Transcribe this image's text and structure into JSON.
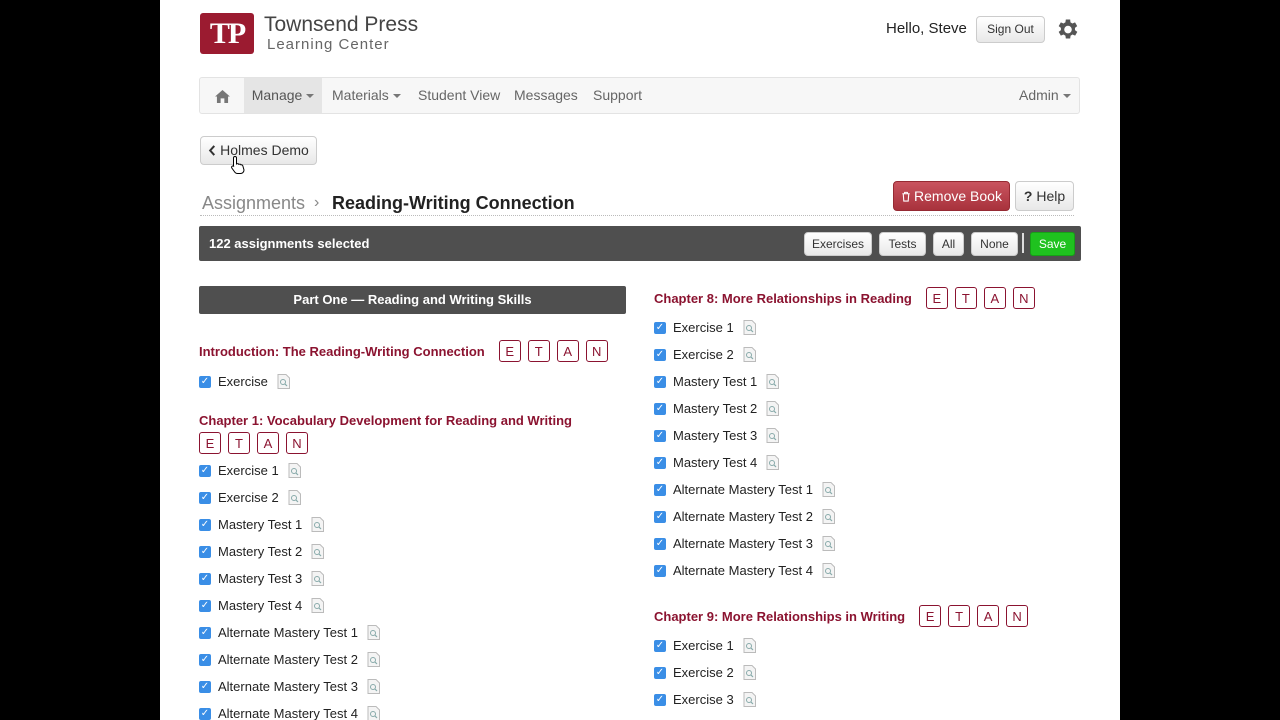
{
  "brand": {
    "logo": "TP",
    "title": "Townsend Press",
    "subtitle": "Learning Center"
  },
  "header": {
    "greeting": "Hello, Steve",
    "sign_out": "Sign Out",
    "settings_icon": "gear-icon"
  },
  "nav": {
    "home_icon": "home-icon",
    "items": [
      "Manage",
      "Materials",
      "Student View",
      "Messages",
      "Support"
    ],
    "right": "Admin"
  },
  "back_label": "Holmes Demo",
  "breadcrumb": {
    "parent": "Assignments",
    "current": "Reading-Writing Connection"
  },
  "actions": {
    "remove_book": "Remove Book",
    "help": "Help"
  },
  "selection": {
    "count_text": "122 assignments selected",
    "buttons": [
      "Exercises",
      "Tests",
      "All",
      "None"
    ],
    "save": "Save"
  },
  "letters": [
    "E",
    "T",
    "A",
    "N"
  ],
  "part_title": "Part One — Reading and Writing Skills",
  "left_sections": [
    {
      "title": "Introduction: The Reading-Writing Connection",
      "items": [
        "Exercise"
      ]
    },
    {
      "title": "Chapter 1: Vocabulary Development for Reading and Writing",
      "items": [
        "Exercise 1",
        "Exercise 2",
        "Mastery Test 1",
        "Mastery Test 2",
        "Mastery Test 3",
        "Mastery Test 4",
        "Alternate Mastery Test 1",
        "Alternate Mastery Test 2",
        "Alternate Mastery Test 3",
        "Alternate Mastery Test 4"
      ]
    }
  ],
  "right_sections": [
    {
      "title": "Chapter 8: More Relationships in Reading",
      "items": [
        "Exercise 1",
        "Exercise 2",
        "Mastery Test 1",
        "Mastery Test 2",
        "Mastery Test 3",
        "Mastery Test 4",
        "Alternate Mastery Test 1",
        "Alternate Mastery Test 2",
        "Alternate Mastery Test 3",
        "Alternate Mastery Test 4"
      ]
    },
    {
      "title": "Chapter 9: More Relationships in Writing",
      "items": [
        "Exercise 1",
        "Exercise 2",
        "Exercise 3"
      ]
    }
  ],
  "colors": {
    "brand": "#9b1b30",
    "danger": "#b03a44",
    "success": "#1fc21f",
    "checkbox": "#3a8ee6"
  }
}
